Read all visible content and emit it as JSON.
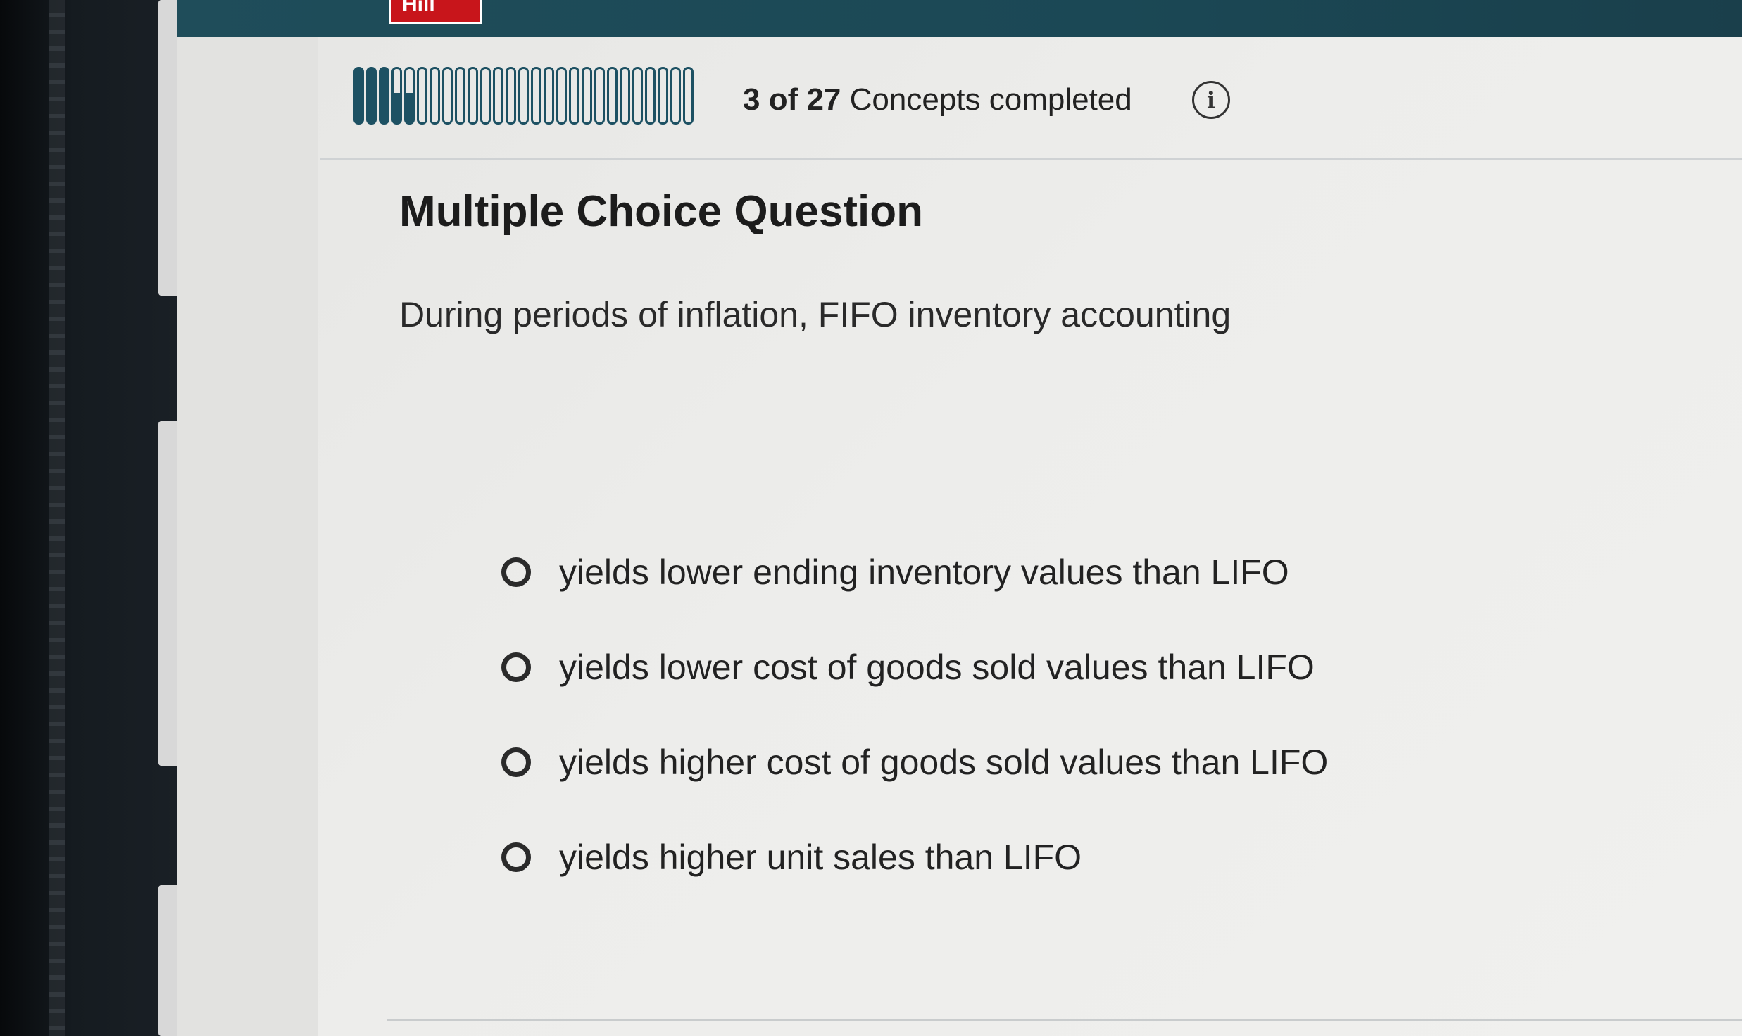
{
  "brand": {
    "logo_text": "Hill",
    "logo_color": "#c8151b"
  },
  "theme": {
    "topbar_color": "#1f4d5a",
    "progress_color": "#1d5163"
  },
  "progress": {
    "completed": 3,
    "total": 27,
    "count_text": "3 of 27",
    "label": "Concepts completed",
    "info_icon_glyph": "i"
  },
  "question": {
    "title": "Multiple Choice Question",
    "stem": "During periods of inflation, FIFO inventory accounting",
    "options": [
      {
        "label": "yields lower ending inventory values than LIFO",
        "selected": false
      },
      {
        "label": "yields lower cost of goods sold values than LIFO",
        "selected": false
      },
      {
        "label": "yields higher cost of goods sold values than LIFO",
        "selected": false
      },
      {
        "label": "yields higher unit sales than LIFO",
        "selected": false
      }
    ]
  }
}
